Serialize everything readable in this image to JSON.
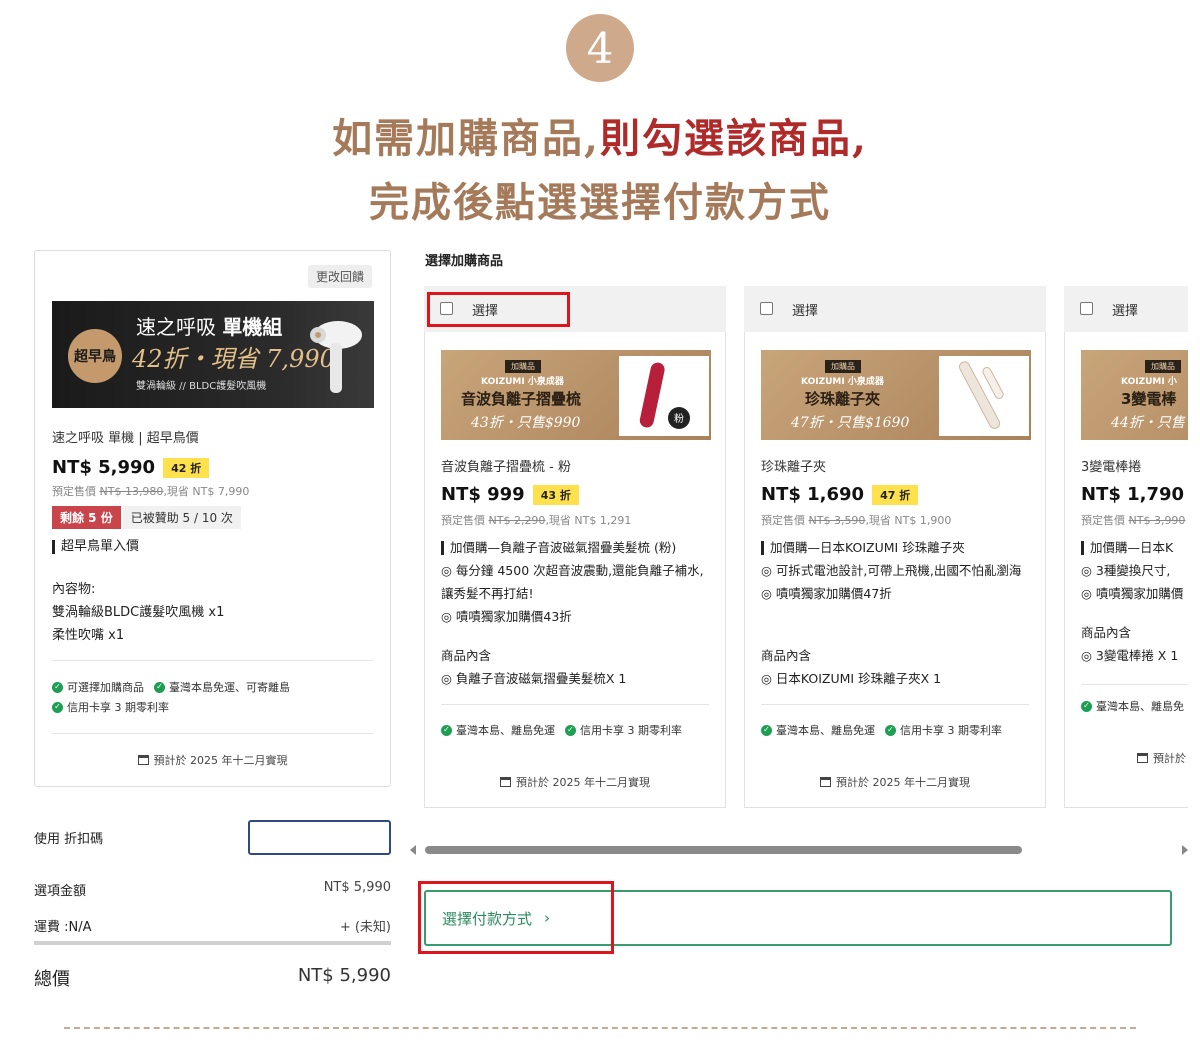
{
  "step": {
    "number": "4"
  },
  "headline": {
    "l1_a": "如需加購商品,",
    "l1_b": "則勾選該商品,",
    "l2": "完成後點選選擇付款方式"
  },
  "main_product": {
    "change_button": "更改回饋",
    "banner": {
      "badge": "超早鳥",
      "title_a": "速之呼吸",
      "title_b": "單機組",
      "sale": "42折・現省 7,990",
      "sub": "雙渦輪級 // BLDC護髮吹風機"
    },
    "name": "速之呼吸 單機 | 超早鳥價",
    "price": "NT$ 5,990",
    "discount": "42 折",
    "orig_label": "預定售價",
    "orig_price": "NT$ 13,980",
    "saving": ",現省 NT$ 7,990",
    "stock_left": "剩餘 5 份",
    "backed": "已被贊助 5 / 10 次",
    "tag_line": "超早鳥單入價",
    "contents_label": "內容物:",
    "content_1": "雙渦輪級BLDC護髮吹風機 x1",
    "content_2": "柔性吹嘴 x1",
    "feat_1": "可選擇加購商品",
    "feat_2": "臺灣本島免運、可寄離島",
    "feat_3": "信用卡享 3 期零利率",
    "ship": "預計於 2025 年十二月實現"
  },
  "addons": {
    "title": "選擇加購商品",
    "select_label": "選擇",
    "items": [
      {
        "banner_tag": "加購品",
        "banner_brand": "KOIZUMI 小泉成器",
        "banner_name": "音波負離子摺疊梳",
        "banner_offer": "43折・只售$990",
        "name": "音波負離子摺疊梳 - 粉",
        "price": "NT$ 999",
        "discount": "43 折",
        "orig_label": "預定售價",
        "orig_price": "NT$ 2,290",
        "saving": ",現省 NT$ 1,291",
        "desc_1": "加價購—負離子音波磁氣摺疊美髮梳 (粉)",
        "desc_2": "◎ 每分鐘 4500 次超音波震動,還能負離子補水,讓秀髮不再打結!",
        "desc_3": "◎ 嘖嘖獨家加購價43折",
        "inc_label": "商品內含",
        "inc_1": "◎ 負離子音波磁氣摺疊美髮梳X 1",
        "feat_1": "臺灣本島、離島免運",
        "feat_2": "信用卡享 3 期零利率",
        "ship": "預計於 2025 年十二月實現"
      },
      {
        "banner_tag": "加購品",
        "banner_brand": "KOIZUMI 小泉成器",
        "banner_name": "珍珠離子夾",
        "banner_offer": "47折・只售$1690",
        "name": "珍珠離子夾",
        "price": "NT$ 1,690",
        "discount": "47 折",
        "orig_label": "預定售價",
        "orig_price": "NT$ 3,590",
        "saving": ",現省 NT$ 1,900",
        "desc_1": "加價購—日本KOIZUMI 珍珠離子夾",
        "desc_2": "◎ 可拆式電池設計,可帶上飛機,出國不怕亂瀏海",
        "desc_3": "◎ 嘖嘖獨家加購價47折",
        "inc_label": "商品內含",
        "inc_1": "◎ 日本KOIZUMI 珍珠離子夾X 1",
        "feat_1": "臺灣本島、離島免運",
        "feat_2": "信用卡享 3 期零利率",
        "ship": "預計於 2025 年十二月實現"
      },
      {
        "banner_tag": "加購品",
        "banner_brand": "KOIZUMI 小",
        "banner_name": "3變電棒",
        "banner_offer": "44折・只售",
        "name": "3變電棒捲",
        "price": "NT$ 1,790",
        "discount": "",
        "orig_label": "預定售價",
        "orig_price": "NT$ 3,990",
        "saving": "",
        "desc_1": "加價購—日本K",
        "desc_2": "◎ 3種變換尺寸,",
        "desc_3": "◎ 嘖嘖獨家加購價",
        "inc_label": "商品內含",
        "inc_1": "◎ 3變電棒捲 X 1",
        "feat_1": "臺灣本島、離島免",
        "feat_2": "",
        "ship": "預計於"
      }
    ]
  },
  "summary": {
    "coupon_label": "使用 折扣碼",
    "coupon_value": "",
    "subtotal_label": "選項金額",
    "subtotal_value": "NT$ 5,990",
    "shipping_label": "運費 :N/A",
    "shipping_value": "+ (未知)",
    "total_label": "總價",
    "total_value": "NT$ 5,990"
  },
  "pay_button": {
    "label": "選擇付款方式",
    "arrow": "›"
  },
  "colors": {
    "accent_green": "#2e8a5e",
    "highlight_red": "#e0141b",
    "heading_brown": "#a57a5a",
    "heading_red": "#b02a2a",
    "discount_yellow": "#ffe14d",
    "stock_red": "#c9454b"
  }
}
